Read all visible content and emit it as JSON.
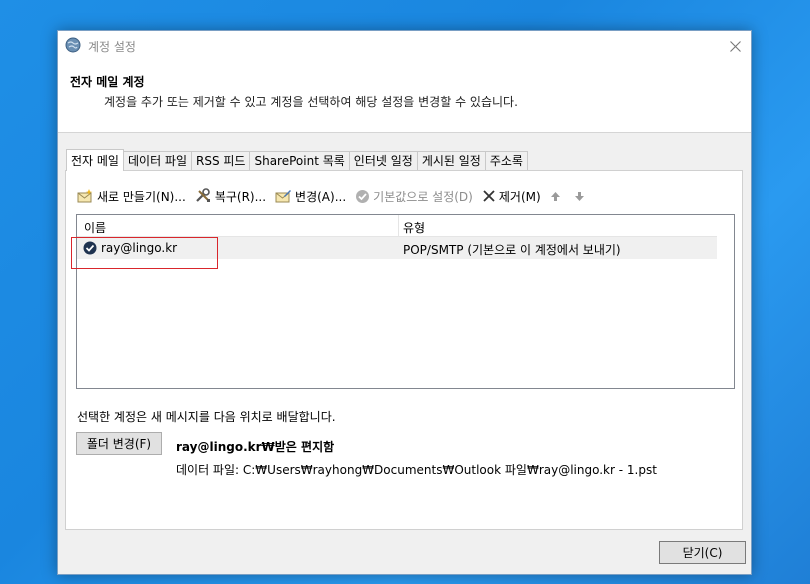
{
  "window": {
    "title": "계정 설정",
    "header_title": "전자 메일 계정",
    "header_subtitle": "계정을 추가 또는 제거할 수 있고 계정을 선택하여 해당 설정을 변경할 수 있습니다."
  },
  "tabs": [
    {
      "label": "전자 메일",
      "active": true
    },
    {
      "label": "데이터 파일",
      "active": false
    },
    {
      "label": "RSS 피드",
      "active": false
    },
    {
      "label": "SharePoint 목록",
      "active": false
    },
    {
      "label": "인터넷 일정",
      "active": false
    },
    {
      "label": "게시된 일정",
      "active": false
    },
    {
      "label": "주소록",
      "active": false
    }
  ],
  "toolbar": {
    "new": "새로 만들기(N)...",
    "repair": "복구(R)...",
    "change": "변경(A)...",
    "set_default": "기본값으로 설정(D)",
    "remove": "제거(M)"
  },
  "list": {
    "col_name": "이름",
    "col_type": "유형",
    "rows": [
      {
        "name": "ray@lingo.kr",
        "type": "POP/SMTP (기본으로 이 계정에서 보내기)",
        "default": true
      }
    ]
  },
  "delivery": {
    "label": "선택한 계정은 새 메시지를 다음 위치로 배달합니다.",
    "change_folder_button": "폴더 변경(F)",
    "folder": "ray@lingo.kr₩받은 편지함",
    "data_file": "데이터 파일: C:₩Users₩rayhong₩Documents₩Outlook 파일₩ray@lingo.kr - 1.pst"
  },
  "footer": {
    "close_button": "닫기(C)"
  },
  "colors": {
    "desktop": "#1a86df",
    "dialog_bg": "#f0f0f0",
    "highlight": "#d9262c"
  }
}
